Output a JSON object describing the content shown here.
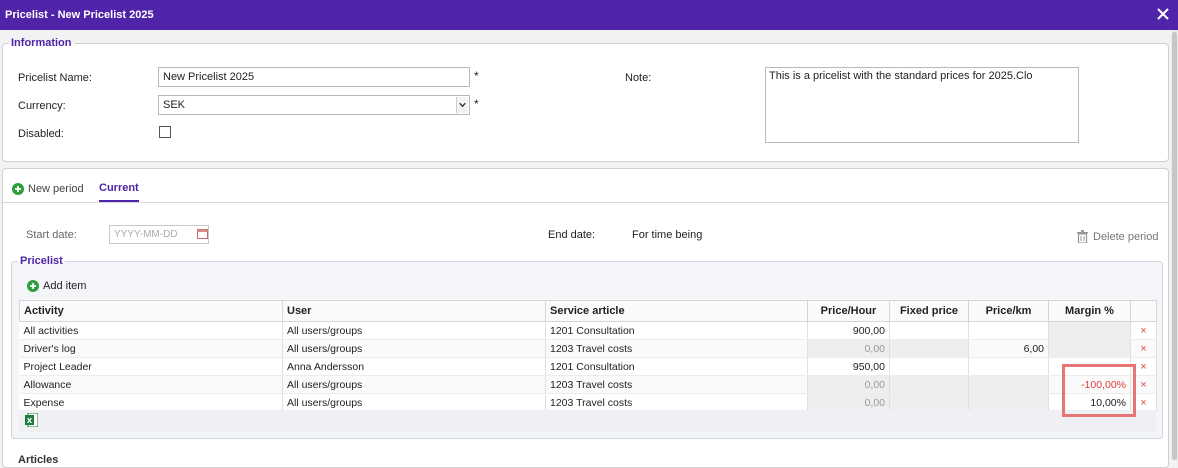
{
  "window": {
    "title": "Pricelist - New Pricelist 2025"
  },
  "information": {
    "legend": "Information",
    "name_label": "Pricelist Name:",
    "name_value": "New Pricelist 2025",
    "currency_label": "Currency:",
    "currency_value": "SEK",
    "disabled_label": "Disabled:",
    "required_mark": "*",
    "note_label": "Note:",
    "note_value": "This is a pricelist with the standard prices for 2025.Clo"
  },
  "tabs": {
    "new_period": "New period",
    "current": "Current"
  },
  "period": {
    "start_label": "Start date:",
    "start_placeholder": "YYYY-MM-DD",
    "end_label": "End date:",
    "end_value": "For time being",
    "delete_label": "Delete period"
  },
  "pricelist": {
    "legend": "Pricelist",
    "add_item": "Add item",
    "columns": [
      "Activity",
      "User",
      "Service article",
      "Price/Hour",
      "Fixed price",
      "Price/km",
      "Margin %"
    ],
    "rows": [
      {
        "activity": "All activities",
        "user": "All users/groups",
        "service": "1201 Consultation",
        "price_hour": "900,00",
        "fixed": "",
        "km": "",
        "margin": ""
      },
      {
        "activity": "Driver's log",
        "user": "All users/groups",
        "service": "1203 Travel costs",
        "price_hour": "0,00",
        "fixed": "",
        "km": "6,00",
        "margin": ""
      },
      {
        "activity": "Project Leader",
        "user": "Anna Andersson",
        "service": "1201 Consultation",
        "price_hour": "950,00",
        "fixed": "",
        "km": "",
        "margin": ""
      },
      {
        "activity": "Allowance",
        "user": "All users/groups",
        "service": "1203 Travel costs",
        "price_hour": "0,00",
        "fixed": "",
        "km": "",
        "margin": "-100,00%"
      },
      {
        "activity": "Expense",
        "user": "All users/groups",
        "service": "1203 Travel costs",
        "price_hour": "0,00",
        "fixed": "",
        "km": "",
        "margin": "10,00%"
      }
    ],
    "delete_glyph": "×"
  },
  "articles_cut": "Articles",
  "colors": {
    "accent": "#4f24a8",
    "highlight": "#e87575",
    "negative": "#e23a3a"
  }
}
